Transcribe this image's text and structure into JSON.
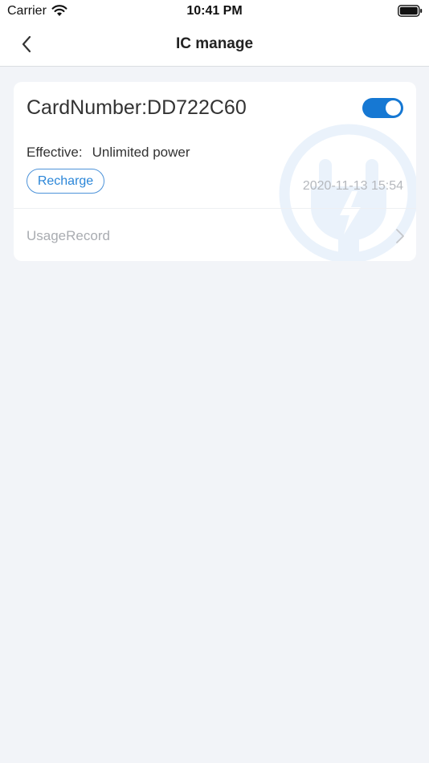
{
  "status_bar": {
    "carrier": "Carrier",
    "time": "10:41 PM"
  },
  "nav": {
    "title": "IC manage"
  },
  "card": {
    "number_text": "CardNumber:DD722C60",
    "enabled": true,
    "effective_label": "Effective:",
    "effective_value": "Unlimited power",
    "recharge_label": "Recharge",
    "timestamp": "2020-11-13 15:54",
    "usage_label": "UsageRecord"
  },
  "colors": {
    "accent": "#1678d3",
    "background": "#f2f4f8",
    "muted_text": "#b5b8bd"
  },
  "icons": {
    "back": "chevron-left-icon",
    "usage": "chevron-right-icon",
    "watermark": "charging-plug-icon"
  }
}
